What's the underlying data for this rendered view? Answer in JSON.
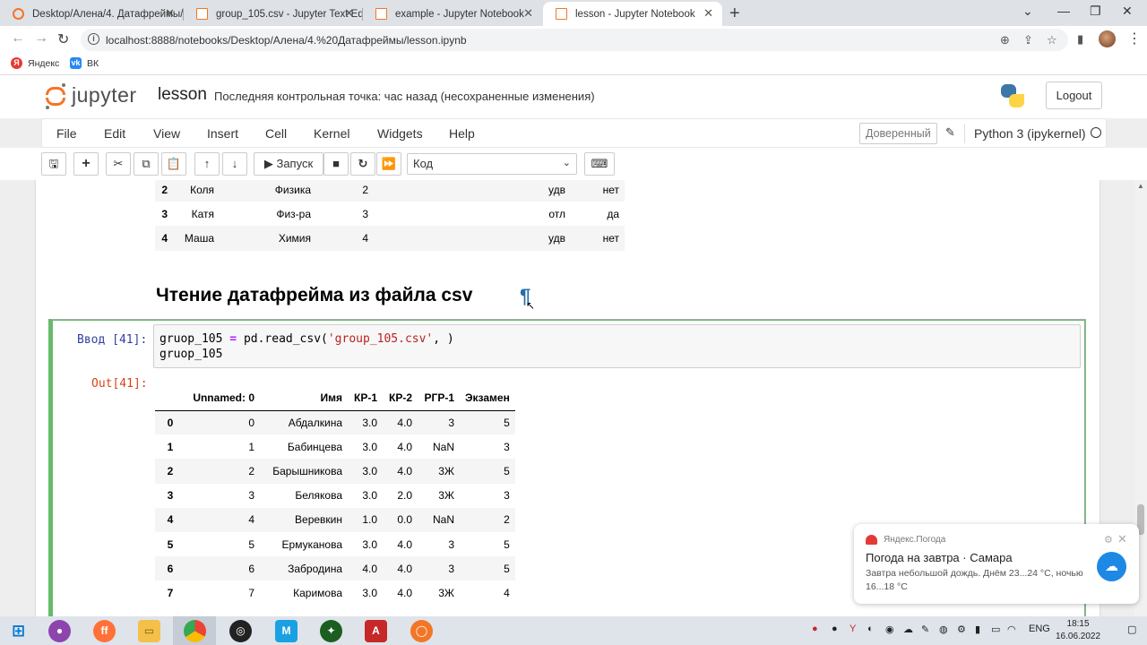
{
  "browser": {
    "tabs": [
      {
        "title": "Desktop/Алена/4. Датафреймы/",
        "active": false
      },
      {
        "title": "group_105.csv - Jupyter Text Edit",
        "active": false
      },
      {
        "title": "example - Jupyter Notebook",
        "active": false
      },
      {
        "title": "lesson - Jupyter Notebook",
        "active": true
      }
    ],
    "url": "localhost:8888/notebooks/Desktop/Алена/4.%20Датафреймы/lesson.ipynb",
    "bookmarks": [
      {
        "label": "Яндекс",
        "icon": "yandex-icon"
      },
      {
        "label": "ВК",
        "icon": "vk-icon"
      }
    ]
  },
  "jupyter": {
    "logo_text": "jupyter",
    "notebook_name": "lesson",
    "checkpoint": "Последняя контрольная точка: час назад   (несохраненные изменения)",
    "logout": "Logout",
    "menu": [
      "File",
      "Edit",
      "View",
      "Insert",
      "Cell",
      "Kernel",
      "Widgets",
      "Help"
    ],
    "trusted": "Доверенный",
    "kernel": "Python 3 (ipykernel)",
    "run_label": "Запуск",
    "cell_type": "Код"
  },
  "top_table": {
    "rows": [
      {
        "idx": "2",
        "name": "Коля",
        "subject": "Физика",
        "num": "2",
        "grade": "удв",
        "flag": "нет"
      },
      {
        "idx": "3",
        "name": "Катя",
        "subject": "Физ-ра",
        "num": "3",
        "grade": "отл",
        "flag": "да"
      },
      {
        "idx": "4",
        "name": "Маша",
        "subject": "Химия",
        "num": "4",
        "grade": "удв",
        "flag": "нет"
      }
    ]
  },
  "markdown_heading": "Чтение датафрейма из файла csv",
  "pilcrow": "¶",
  "cell": {
    "in_prompt": "Ввод [41]:",
    "out_prompt": "Out[41]:",
    "code_line1_var": "gruop_105",
    "code_line1_op": "=",
    "code_line1_call": "pd.read_csv(",
    "code_line1_str": "'group_105.csv'",
    "code_line1_end": ", )",
    "code_line2": "gruop_105"
  },
  "df": {
    "columns": [
      "Unnamed: 0",
      "Имя",
      "КР-1",
      "КР-2",
      "РГР-1",
      "Экзамен"
    ],
    "rows": [
      {
        "idx": "0",
        "c0": "0",
        "name": "Абдалкина",
        "kr1": "3.0",
        "kr2": "4.0",
        "rgr": "3",
        "exam": "5"
      },
      {
        "idx": "1",
        "c0": "1",
        "name": "Бабинцева",
        "kr1": "3.0",
        "kr2": "4.0",
        "rgr": "NaN",
        "exam": "3"
      },
      {
        "idx": "2",
        "c0": "2",
        "name": "Барышникова",
        "kr1": "3.0",
        "kr2": "4.0",
        "rgr": "3Ж",
        "exam": "5"
      },
      {
        "idx": "3",
        "c0": "3",
        "name": "Белякова",
        "kr1": "3.0",
        "kr2": "2.0",
        "rgr": "3Ж",
        "exam": "3"
      },
      {
        "idx": "4",
        "c0": "4",
        "name": "Веревкин",
        "kr1": "1.0",
        "kr2": "0.0",
        "rgr": "NaN",
        "exam": "2"
      },
      {
        "idx": "5",
        "c0": "5",
        "name": "Ермуканова",
        "kr1": "3.0",
        "kr2": "4.0",
        "rgr": "3",
        "exam": "5"
      },
      {
        "idx": "6",
        "c0": "6",
        "name": "Забродина",
        "kr1": "4.0",
        "kr2": "4.0",
        "rgr": "3",
        "exam": "5"
      },
      {
        "idx": "7",
        "c0": "7",
        "name": "Каримова",
        "kr1": "3.0",
        "kr2": "4.0",
        "rgr": "3Ж",
        "exam": "4"
      }
    ]
  },
  "weather": {
    "source": "Яндекс.Погода",
    "title": "Погода на завтра · Самара",
    "body": "Завтра небольшой дождь. Днём 23...24 °C, ночью 16...18 °C"
  },
  "taskbar": {
    "lang": "ENG",
    "time": "18:15",
    "date": "16.06.2022"
  }
}
